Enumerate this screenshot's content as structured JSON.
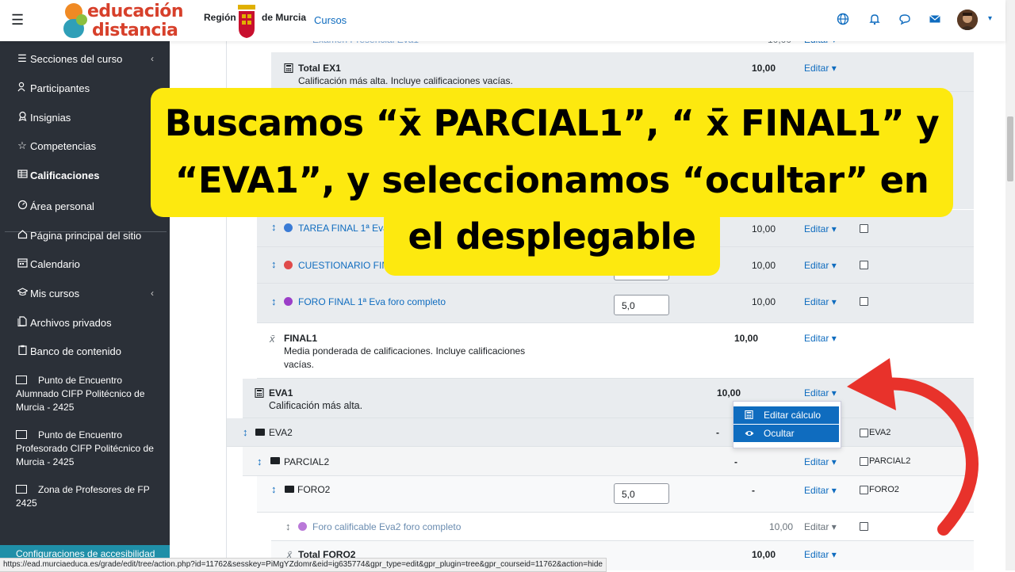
{
  "navbar": {
    "logo_line1": "educación",
    "logo_line2": "distancia",
    "logo_prefix_1": "e",
    "logo_prefix_2": "a",
    "region_1": "Región",
    "region_2": "de Murcia",
    "cursos_link": "Cursos"
  },
  "sidebar": {
    "items": [
      {
        "label": "Secciones del curso",
        "icon": "list-icon"
      },
      {
        "label": "Participantes",
        "icon": "users-icon"
      },
      {
        "label": "Insignias",
        "icon": "badge-icon"
      },
      {
        "label": "Competencias",
        "icon": "star-icon"
      },
      {
        "label": "Calificaciones",
        "icon": "table-icon"
      },
      {
        "label": "Área personal",
        "icon": "dashboard-icon"
      },
      {
        "label": "Página principal del sitio",
        "icon": "home-icon"
      },
      {
        "label": "Calendario",
        "icon": "calendar-icon"
      },
      {
        "label": "Mis cursos",
        "icon": "graduation-icon"
      },
      {
        "label": "Archivos privados",
        "icon": "file-icon"
      },
      {
        "label": "Banco de contenido",
        "icon": "clipboard-icon"
      }
    ],
    "courses": [
      {
        "label": "Punto de Encuentro Alumnado CIFP Politécnico de Murcia - 2425"
      },
      {
        "label": "Punto de Encuentro Profesorado CIFP Politécnico de Murcia - 2425"
      },
      {
        "label": "Zona de Profesores de FP 2425"
      }
    ],
    "accessibility": "Configuraciones de accesibilidad"
  },
  "grades": {
    "top_partial": "Examen Presencial Eva1",
    "top_partial_value": "10,00",
    "total_ex1": {
      "name": "Total EX1",
      "desc": "Calificación más alta. Incluye calificaciones vacías.",
      "value": "10,00"
    },
    "tarea_final": {
      "name": "TAREA FINAL 1ª Eva",
      "value": "10,00"
    },
    "cuestionario_final": {
      "name": "CUESTIONARIO FINAL",
      "value": "10,00"
    },
    "foro_final": {
      "name": "FORO FINAL 1ª Eva foro completo",
      "input": "5,0",
      "value": "10,00"
    },
    "final1": {
      "name": "FINAL1",
      "desc_1": "Media ponderada de calificaciones. Incluye calificaciones",
      "desc_2": "vacías.",
      "value": "10,00"
    },
    "eva1": {
      "name": "EVA1",
      "desc": "Calificación más alta.",
      "value": "10,00"
    },
    "eva2": {
      "name": "EVA2",
      "value": "-",
      "check_label": "EVA2"
    },
    "parcial2": {
      "name": "PARCIAL2",
      "value": "-",
      "check_label": "PARCIAL2"
    },
    "foro2": {
      "name": "FORO2",
      "input": "5,0",
      "value": "-",
      "check_label": "FORO2"
    },
    "foro_calificable": {
      "name": "Foro calificable Eva2 foro completo",
      "value": "10,00"
    },
    "total_foro2": {
      "name": "Total FORO2",
      "value": "10,00"
    },
    "editar": "Editar",
    "dropdown": {
      "item1": "Editar cálculo",
      "item2": "Ocultar"
    }
  },
  "callout": {
    "line1": "Buscamos “x̄ PARCIAL1”, “ x̄ FINAL1” y",
    "line2": "“EVA1”, y seleccionamos “ocultar” en",
    "line3": "el desplegable"
  },
  "status_url": "https://ead.murciaeduca.es/grade/edit/tree/action.php?id=11762&sesskey=PiMgYZdomr&eid=ig635774&gpr_type=edit&gpr_plugin=tree&gpr_courseid=11762&action=hide",
  "colors": {
    "accent": "#0f6cbf",
    "sidebar_bg": "#2b3038",
    "callout": "#fde90f",
    "arrow": "#e8322b",
    "logo": "#d7402b"
  }
}
